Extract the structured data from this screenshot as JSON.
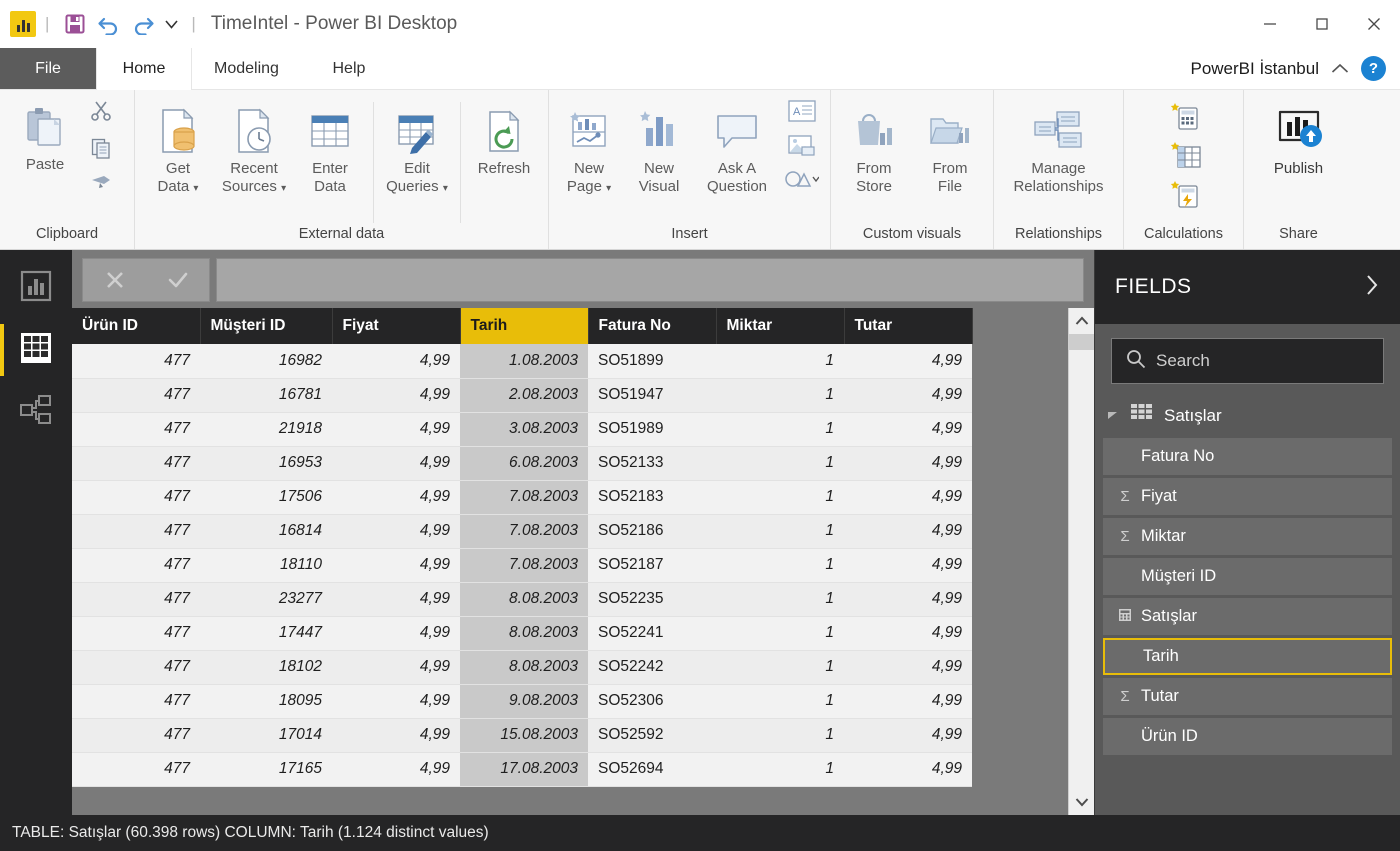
{
  "window": {
    "title": "TimeIntel - Power BI Desktop",
    "app_icon": "powerbi-logo-icon",
    "minimize": "−",
    "maximize": "□",
    "close": "×"
  },
  "quick_access": {
    "save": "save-icon",
    "undo": "undo-icon",
    "redo": "redo-icon",
    "customize": "chevron-down-icon",
    "separator": "|"
  },
  "tabs": [
    {
      "label": "File",
      "active": false,
      "style": "file"
    },
    {
      "label": "Home",
      "active": true,
      "style": "normal"
    },
    {
      "label": "Modeling",
      "active": false,
      "style": "normal"
    },
    {
      "label": "Help",
      "active": false,
      "style": "normal"
    }
  ],
  "account": {
    "name": "PowerBI İstanbul",
    "collapse_icon": "chevron-up-icon",
    "help_label": "?"
  },
  "ribbon": {
    "groups": [
      {
        "label": "Clipboard",
        "buttons": [
          {
            "label1": "Paste",
            "label2": "",
            "icon": "paste-icon"
          }
        ],
        "small_buttons": [
          {
            "icon": "cut-icon",
            "label": "Cut"
          },
          {
            "icon": "copy-icon",
            "label": "Copy"
          },
          {
            "icon": "format-painter-icon",
            "label": "Format Painter"
          }
        ]
      },
      {
        "label": "External data",
        "buttons": [
          {
            "label1": "Get",
            "label2": "Data",
            "dropdown": true,
            "icon": "get-data-icon"
          },
          {
            "label1": "Recent",
            "label2": "Sources",
            "dropdown": true,
            "icon": "recent-sources-icon"
          },
          {
            "label1": "Enter",
            "label2": "Data",
            "dropdown": false,
            "icon": "enter-data-icon"
          },
          {
            "label1": "Edit",
            "label2": "Queries",
            "dropdown": true,
            "icon": "edit-queries-icon"
          },
          {
            "label1": "Refresh",
            "label2": "",
            "dropdown": false,
            "icon": "refresh-icon"
          }
        ]
      },
      {
        "label": "Insert",
        "buttons": [
          {
            "label1": "New",
            "label2": "Page",
            "dropdown": true,
            "icon": "new-page-icon"
          },
          {
            "label1": "New",
            "label2": "Visual",
            "dropdown": false,
            "icon": "new-visual-icon"
          },
          {
            "label1": "Ask A",
            "label2": "Question",
            "dropdown": false,
            "icon": "ask-a-question-icon"
          }
        ],
        "small_buttons": [
          {
            "icon": "text-box-icon",
            "label": "Text Box"
          },
          {
            "icon": "image-icon",
            "label": "Image"
          },
          {
            "icon": "shapes-icon",
            "label": "Shapes"
          }
        ]
      },
      {
        "label": "Custom visuals",
        "buttons": [
          {
            "label1": "From",
            "label2": "Store",
            "dropdown": false,
            "icon": "from-store-icon"
          },
          {
            "label1": "From",
            "label2": "File",
            "dropdown": false,
            "icon": "from-file-icon"
          }
        ]
      },
      {
        "label": "Relationships",
        "buttons": [
          {
            "label1": "Manage",
            "label2": "Relationships",
            "dropdown": false,
            "icon": "manage-relationships-icon"
          }
        ]
      },
      {
        "label": "Calculations",
        "buttons": [],
        "small_buttons": [
          {
            "icon": "new-measure-icon",
            "label": "New Measure"
          },
          {
            "icon": "new-column-icon",
            "label": "New Column"
          },
          {
            "icon": "new-quick-measure-icon",
            "label": "New Quick Measure"
          }
        ]
      },
      {
        "label": "Share",
        "buttons": [
          {
            "label1": "Publish",
            "label2": "",
            "dropdown": false,
            "icon": "publish-icon"
          }
        ]
      }
    ]
  },
  "view_rail": [
    {
      "name": "report-view",
      "icon": "chart-icon",
      "selected": false
    },
    {
      "name": "data-view",
      "icon": "table-icon",
      "selected": true
    },
    {
      "name": "relationships-view",
      "icon": "model-icon",
      "selected": false
    }
  ],
  "formula_bar": {
    "cancel_icon": "close-icon",
    "accept_icon": "check-icon",
    "value": "",
    "placeholder": "",
    "expand_icon": "chevron-down-icon"
  },
  "grid": {
    "columns": [
      {
        "label": "Ürün ID",
        "align": "num",
        "highlighted": false
      },
      {
        "label": "Müşteri ID",
        "align": "num",
        "highlighted": false
      },
      {
        "label": "Fiyat",
        "align": "num",
        "highlighted": false
      },
      {
        "label": "Tarih",
        "align": "num",
        "highlighted": true
      },
      {
        "label": "Fatura No",
        "align": "txt",
        "highlighted": false
      },
      {
        "label": "Miktar",
        "align": "num",
        "highlighted": false
      },
      {
        "label": "Tutar",
        "align": "num",
        "highlighted": false
      }
    ],
    "rows": [
      [
        "477",
        "16982",
        "4,99",
        "1.08.2003",
        "SO51899",
        "1",
        "4,99"
      ],
      [
        "477",
        "16781",
        "4,99",
        "2.08.2003",
        "SO51947",
        "1",
        "4,99"
      ],
      [
        "477",
        "21918",
        "4,99",
        "3.08.2003",
        "SO51989",
        "1",
        "4,99"
      ],
      [
        "477",
        "16953",
        "4,99",
        "6.08.2003",
        "SO52133",
        "1",
        "4,99"
      ],
      [
        "477",
        "17506",
        "4,99",
        "7.08.2003",
        "SO52183",
        "1",
        "4,99"
      ],
      [
        "477",
        "16814",
        "4,99",
        "7.08.2003",
        "SO52186",
        "1",
        "4,99"
      ],
      [
        "477",
        "18110",
        "4,99",
        "7.08.2003",
        "SO52187",
        "1",
        "4,99"
      ],
      [
        "477",
        "23277",
        "4,99",
        "8.08.2003",
        "SO52235",
        "1",
        "4,99"
      ],
      [
        "477",
        "17447",
        "4,99",
        "8.08.2003",
        "SO52241",
        "1",
        "4,99"
      ],
      [
        "477",
        "18102",
        "4,99",
        "8.08.2003",
        "SO52242",
        "1",
        "4,99"
      ],
      [
        "477",
        "18095",
        "4,99",
        "9.08.2003",
        "SO52306",
        "1",
        "4,99"
      ],
      [
        "477",
        "17014",
        "4,99",
        "15.08.2003",
        "SO52592",
        "1",
        "4,99"
      ],
      [
        "477",
        "17165",
        "4,99",
        "17.08.2003",
        "SO52694",
        "1",
        "4,99"
      ]
    ],
    "scrollbar": {
      "up_icon": "chevron-up-icon",
      "down_icon": "chevron-down-icon"
    }
  },
  "fields_pane": {
    "title": "FIELDS",
    "expand_icon": "chevron-right-icon",
    "search_placeholder": "Search",
    "search_value": "",
    "search_icon": "search-icon",
    "table": {
      "name": "Satışlar",
      "expand_icon": "triangle-collapse-icon",
      "table_icon": "table-icon",
      "fields": [
        {
          "label": "Fatura No",
          "aggregate": "",
          "selected": false,
          "icon": ""
        },
        {
          "label": "Fiyat",
          "aggregate": "Σ",
          "selected": false,
          "icon": ""
        },
        {
          "label": "Miktar",
          "aggregate": "Σ",
          "selected": false,
          "icon": ""
        },
        {
          "label": "Müşteri ID",
          "aggregate": "",
          "selected": false,
          "icon": ""
        },
        {
          "label": "Satışlar",
          "aggregate": "",
          "selected": false,
          "icon": "measure-icon"
        },
        {
          "label": "Tarih",
          "aggregate": "",
          "selected": true,
          "icon": ""
        },
        {
          "label": "Tutar",
          "aggregate": "Σ",
          "selected": false,
          "icon": ""
        },
        {
          "label": "Ürün ID",
          "aggregate": "",
          "selected": false,
          "icon": ""
        }
      ]
    }
  },
  "status_bar": {
    "text": "TABLE: Satışlar (60.398 rows) COLUMN: Tarih (1.124 distinct values)"
  },
  "colors": {
    "accent_yellow": "#e8bd09",
    "dark_chrome": "#252526",
    "canvas_gray": "#7a7a7a",
    "fields_gray": "#595959",
    "help_blue": "#1b82d2"
  }
}
